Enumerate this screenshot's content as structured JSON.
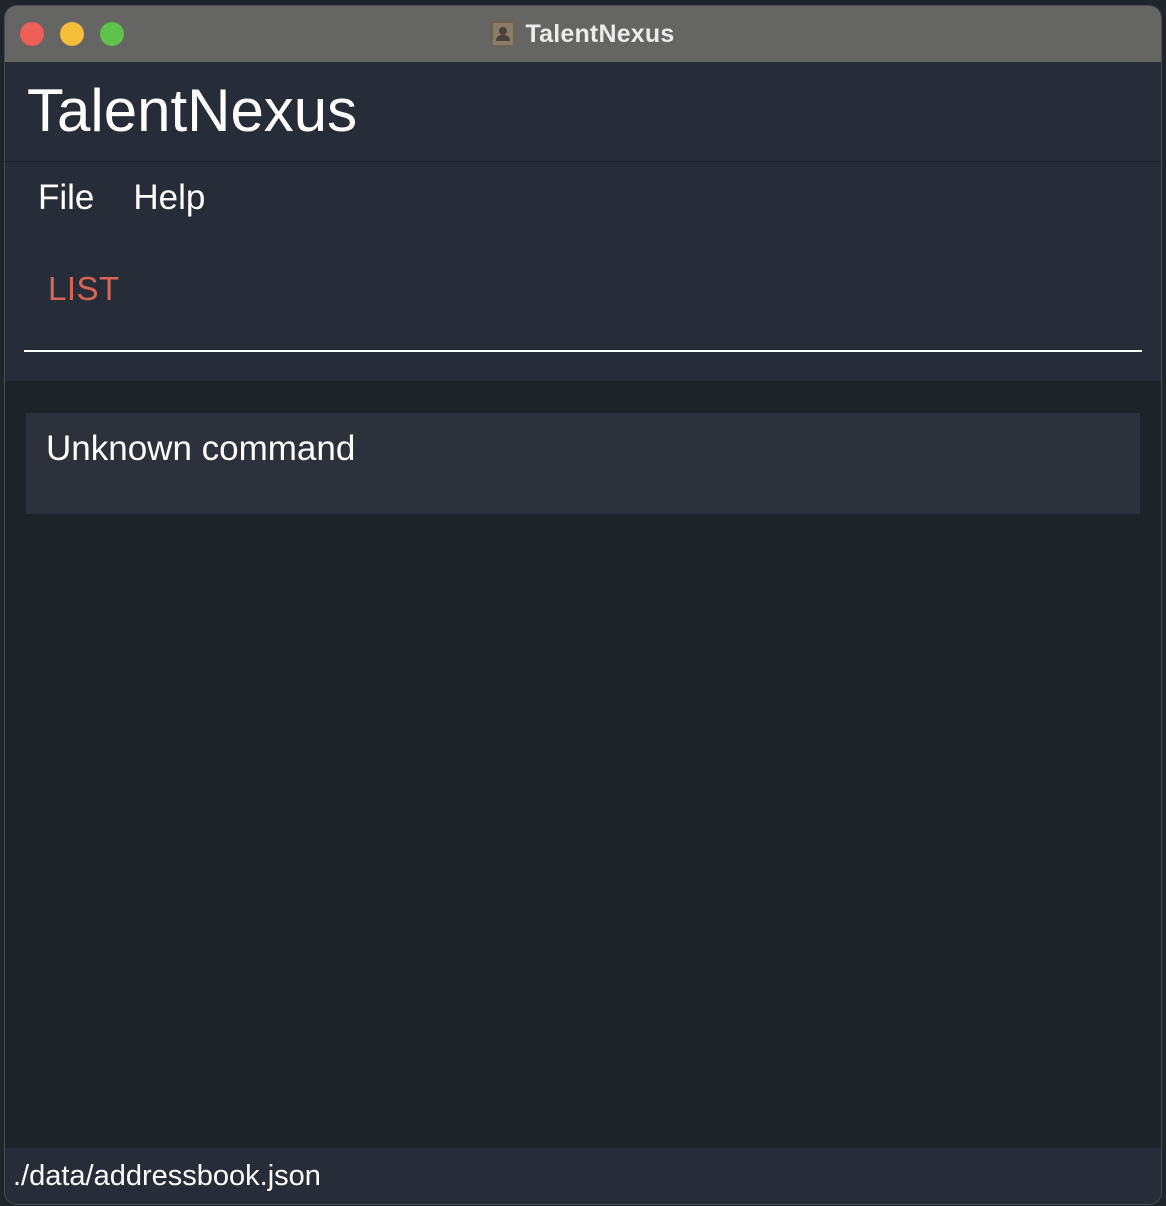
{
  "window": {
    "title": "TalentNexus",
    "proxy_icon": "contacts-book-icon"
  },
  "header": {
    "app_title": "TalentNexus"
  },
  "menubar": {
    "items": [
      {
        "label": "File"
      },
      {
        "label": "Help"
      }
    ]
  },
  "command_box": {
    "value": "LIST"
  },
  "result_display": {
    "message": "Unknown command"
  },
  "status_bar": {
    "save_location": "./data/addressbook.json"
  },
  "colors": {
    "background": "#1e232a",
    "panel": "#272d38",
    "command_text_error": "#d96654",
    "titlebar": "#656563"
  }
}
